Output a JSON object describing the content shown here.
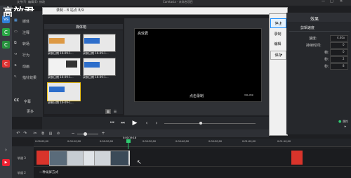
{
  "watermark": "高效君",
  "app": {
    "title": "Camtasia - 未命名项目",
    "menu": [
      "文件(F)",
      "编辑(E)",
      "修改"
    ]
  },
  "toolbar": {
    "zoom": "33%"
  },
  "sidebar": {
    "items": [
      {
        "label": "媒体"
      },
      {
        "label": "注释"
      },
      {
        "label": "转场"
      },
      {
        "label": "行为"
      },
      {
        "label": "动画"
      },
      {
        "label": "指针效果"
      },
      {
        "label": "字幕"
      },
      {
        "label": "更多"
      }
    ]
  },
  "media_bin": {
    "header": "媒体箱",
    "items": [
      {
        "label": "录制日期 16-09-1..."
      },
      {
        "label": "录制日期 16-09-1..."
      },
      {
        "label": "录制日期 16-09-1..."
      },
      {
        "label": "录制日期 16-09-1..."
      },
      {
        "label": "录制日期 16-09-1..."
      }
    ]
  },
  "preview": {
    "title_text": "高效君",
    "caption": "点击录制",
    "badge": "VOL.059"
  },
  "dialog": {
    "title": "录制 - 8 站点 8/9",
    "buttons": [
      "停止",
      "录制",
      "编辑",
      "保存"
    ]
  },
  "properties": {
    "title": "效果",
    "section": "剪辑速度",
    "fields": [
      {
        "label": "速度:",
        "value": "4.40x"
      },
      {
        "label": "持续时间:",
        "value": "0"
      },
      {
        "label": "帧:",
        "value": "0"
      },
      {
        "label": "秒:",
        "value": "2"
      },
      {
        "label": "秒:",
        "value": "8"
      }
    ],
    "export_label": "属性"
  },
  "timeline": {
    "ruler": [
      "0:00:00;00",
      "0:00:10;00",
      "0:00:20;00",
      "0:00:30;00",
      "0:00:40;00",
      "0:00:50;00",
      "0:01:00;00",
      "0:01:10;00"
    ],
    "playhead_time": "0:00:19;18",
    "tracks": [
      {
        "label": "轨道 3",
        "clip_text": ""
      },
      {
        "label": "轨道 2",
        "clip_text": "一种录屏方式"
      }
    ]
  },
  "colors": {
    "accent": "#1e90ff",
    "clip_red": "#d9342b",
    "panel": "#2b2d31"
  }
}
